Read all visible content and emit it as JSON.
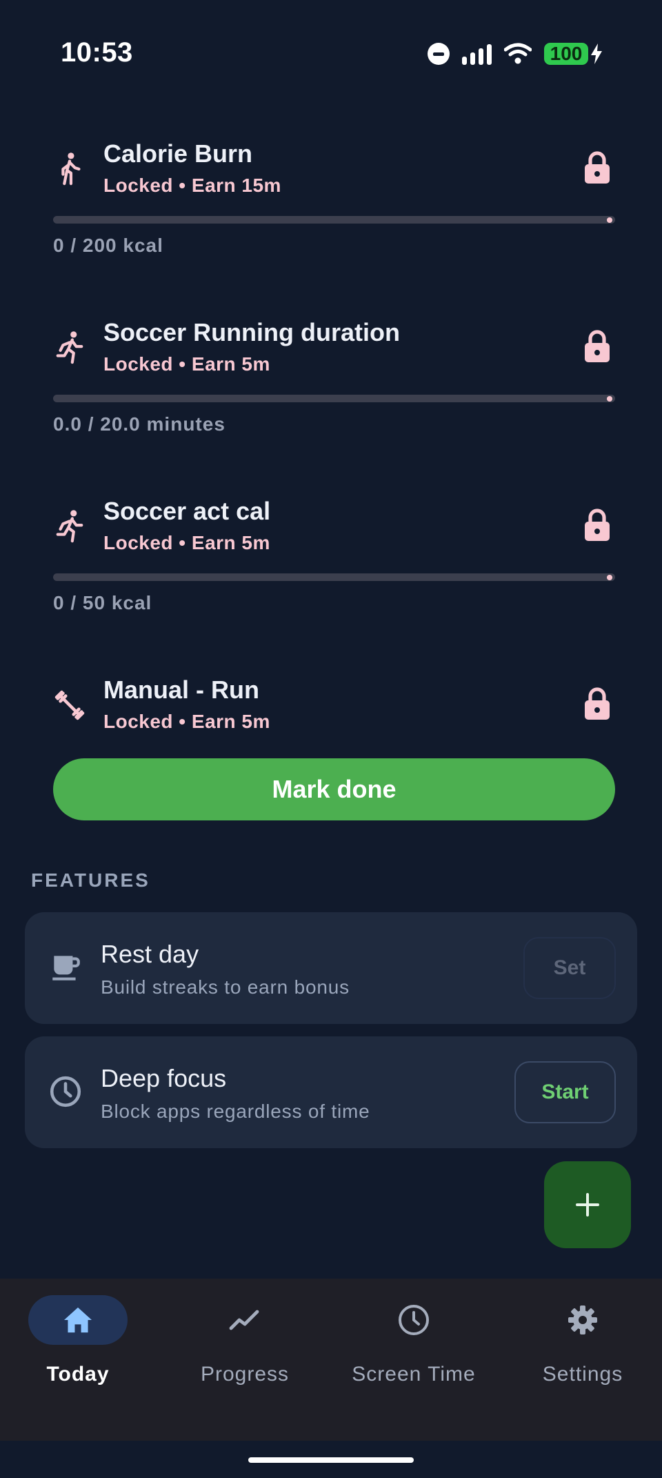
{
  "status_bar": {
    "time": "10:53",
    "battery": "100"
  },
  "goals": [
    {
      "title": "Calorie Burn",
      "subtitle": "Locked • Earn 15m",
      "progress_text": "0 / 200 kcal",
      "progress": 0,
      "icon": "walk-icon"
    },
    {
      "title": "Soccer Running duration",
      "subtitle": "Locked • Earn 5m",
      "progress_text": "0.0 / 20.0 minutes",
      "progress": 0,
      "icon": "run-icon"
    },
    {
      "title": "Soccer act cal",
      "subtitle": "Locked • Earn 5m",
      "progress_text": "0 / 50 kcal",
      "progress": 0,
      "icon": "run-icon"
    },
    {
      "title": "Manual - Run",
      "subtitle": "Locked • Earn 5m",
      "icon": "dumbbell-icon"
    }
  ],
  "mark_done_label": "Mark done",
  "features": {
    "section_label": "FEATURES",
    "rest_day": {
      "title": "Rest day",
      "subtitle": "Build streaks to earn bonus",
      "button": "Set",
      "icon": "coffee-cup-icon"
    },
    "deep_focus": {
      "title": "Deep focus",
      "subtitle": "Block apps regardless of time",
      "button": "Start",
      "icon": "clock-icon"
    }
  },
  "fab": {
    "icon": "plus-icon"
  },
  "nav": {
    "items": [
      {
        "label": "Today",
        "icon": "home-icon",
        "active": true
      },
      {
        "label": "Progress",
        "icon": "trending-icon",
        "active": false
      },
      {
        "label": "Screen Time",
        "icon": "clock-icon",
        "active": false
      },
      {
        "label": "Settings",
        "icon": "gear-icon",
        "active": false
      }
    ]
  },
  "colors": {
    "background": "#111a2c",
    "accent_pink": "#f8c8d2",
    "primary_green": "#4caf50",
    "fab_green": "#1e5b24",
    "card": "#1f2a3e",
    "nav_background": "#1f1f27",
    "nav_active_pill": "#223458"
  }
}
